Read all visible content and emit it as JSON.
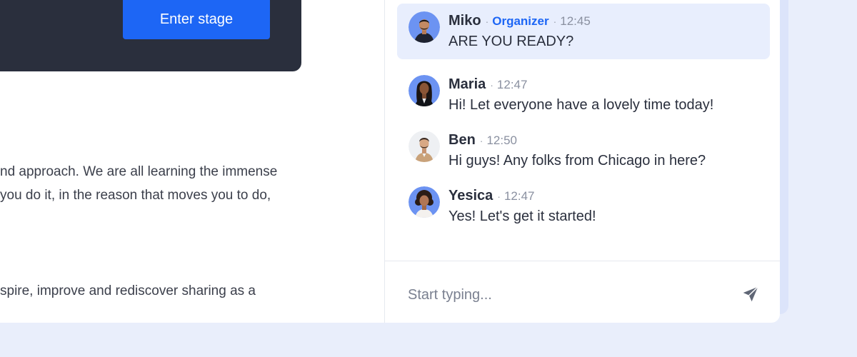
{
  "stage": {
    "enter_label": "Enter stage"
  },
  "description": {
    "lines": [
      "nd approach. We are all learning the immense",
      "you do it, in the reason that moves you to do,",
      "spire, improve and rediscover sharing as a"
    ]
  },
  "chat": {
    "messages": [
      {
        "author": "Miko",
        "role": "Organizer",
        "time": "12:45",
        "text": "ARE YOU READY?",
        "highlighted": true
      },
      {
        "author": "Maria",
        "role": "",
        "time": "12:47",
        "text": "Hi! Let everyone have a lovely time today!",
        "highlighted": false
      },
      {
        "author": "Ben",
        "role": "",
        "time": "12:50",
        "text": "Hi guys! Any folks from Chicago in here?",
        "highlighted": false
      },
      {
        "author": "Yesica",
        "role": "",
        "time": "12:47",
        "text": "Yes! Let's get it started!",
        "highlighted": false
      }
    ],
    "input": {
      "placeholder": "Start typing...",
      "value": ""
    },
    "send_icon": "send-icon"
  },
  "colors": {
    "accent": "#1D66F5",
    "banner": "#2A2F3D",
    "highlight": "#E8EEFD",
    "page_background": "#E9EEFB"
  }
}
